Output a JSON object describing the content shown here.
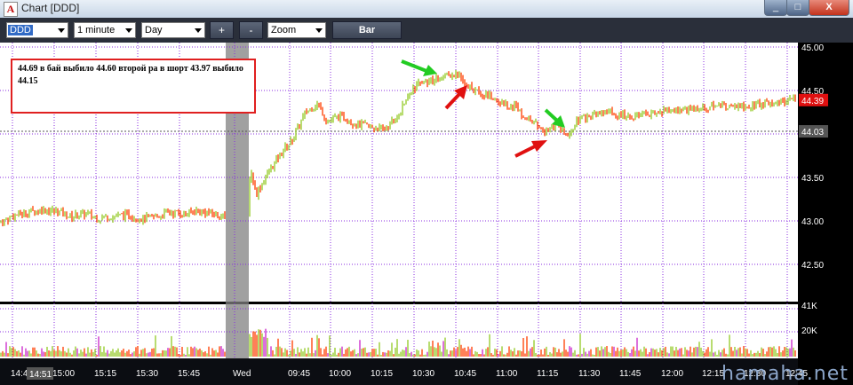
{
  "window": {
    "title": "Chart [DDD]",
    "app_icon_glyph": "A"
  },
  "window_controls": {
    "minimize": "_",
    "maximize": "□",
    "close": "X"
  },
  "toolbar": {
    "symbol": "DDD",
    "interval": "1 minute",
    "range": "Day",
    "zoom_in": "+",
    "zoom_out": "-",
    "zoom": "Zoom",
    "bar": "Bar"
  },
  "annotation": {
    "text": "44.69 в бай выбило 44.60 второй ра в шорт 43.97 выбило 44.15",
    "border_color": "#e02020"
  },
  "watermark": "hamaha.net",
  "colors": {
    "up": "#9acd32",
    "down": "#ff4a10",
    "bg": "#ffffff",
    "grid": "#8a2be2"
  },
  "chart_data": {
    "type": "bar",
    "price_axis": {
      "ticks": [
        "45.00",
        "44.50",
        "44.00",
        "43.50",
        "43.00",
        "42.50"
      ],
      "ylim": [
        42.2,
        45.05
      ]
    },
    "last_price_label": "44.39",
    "reference_price_label": "44.03",
    "volume_axis": {
      "ticks": [
        "41K",
        "20K"
      ]
    },
    "time_axis": {
      "ticks": [
        "14:45",
        "15:00",
        "15:15",
        "15:30",
        "15:45",
        "Wed",
        "09:45",
        "10:00",
        "10:15",
        "10:30",
        "10:45",
        "11:00",
        "11:15",
        "11:30",
        "11:45",
        "12:00",
        "12:15",
        "12:30",
        "12:45"
      ],
      "cursor_label": "14:51"
    },
    "price_path": [
      [
        0,
        42.98
      ],
      [
        16,
        43.06
      ],
      [
        32,
        43.1
      ],
      [
        48,
        43.13
      ],
      [
        64,
        43.11
      ],
      [
        80,
        43.05
      ],
      [
        96,
        43.08
      ],
      [
        112,
        43.03
      ],
      [
        128,
        43.05
      ],
      [
        144,
        43.07
      ],
      [
        160,
        43.02
      ],
      [
        176,
        43.05
      ],
      [
        192,
        43.1
      ],
      [
        208,
        43.08
      ],
      [
        224,
        43.12
      ],
      [
        240,
        43.08
      ],
      [
        254,
        43.04
      ],
      [
        270,
        43.18
      ],
      [
        276,
        43.05
      ],
      [
        282,
        43.6
      ],
      [
        288,
        43.3
      ],
      [
        296,
        43.45
      ],
      [
        312,
        43.72
      ],
      [
        328,
        43.92
      ],
      [
        344,
        44.25
      ],
      [
        358,
        44.35
      ],
      [
        368,
        44.15
      ],
      [
        384,
        44.2
      ],
      [
        400,
        44.12
      ],
      [
        416,
        44.08
      ],
      [
        432,
        44.05
      ],
      [
        448,
        44.2
      ],
      [
        460,
        44.45
      ],
      [
        472,
        44.6
      ],
      [
        486,
        44.62
      ],
      [
        500,
        44.7
      ],
      [
        516,
        44.68
      ],
      [
        532,
        44.5
      ],
      [
        548,
        44.45
      ],
      [
        564,
        44.35
      ],
      [
        580,
        44.32
      ],
      [
        596,
        44.15
      ],
      [
        612,
        44.05
      ],
      [
        628,
        44.1
      ],
      [
        640,
        43.95
      ],
      [
        650,
        44.15
      ],
      [
        664,
        44.2
      ],
      [
        680,
        44.25
      ],
      [
        696,
        44.22
      ],
      [
        712,
        44.2
      ],
      [
        728,
        44.22
      ],
      [
        744,
        44.25
      ],
      [
        760,
        44.28
      ],
      [
        776,
        44.28
      ],
      [
        792,
        44.3
      ],
      [
        808,
        44.33
      ],
      [
        824,
        44.3
      ],
      [
        840,
        44.32
      ],
      [
        856,
        44.35
      ],
      [
        872,
        44.36
      ],
      [
        888,
        44.38
      ],
      [
        898,
        44.39
      ]
    ]
  }
}
